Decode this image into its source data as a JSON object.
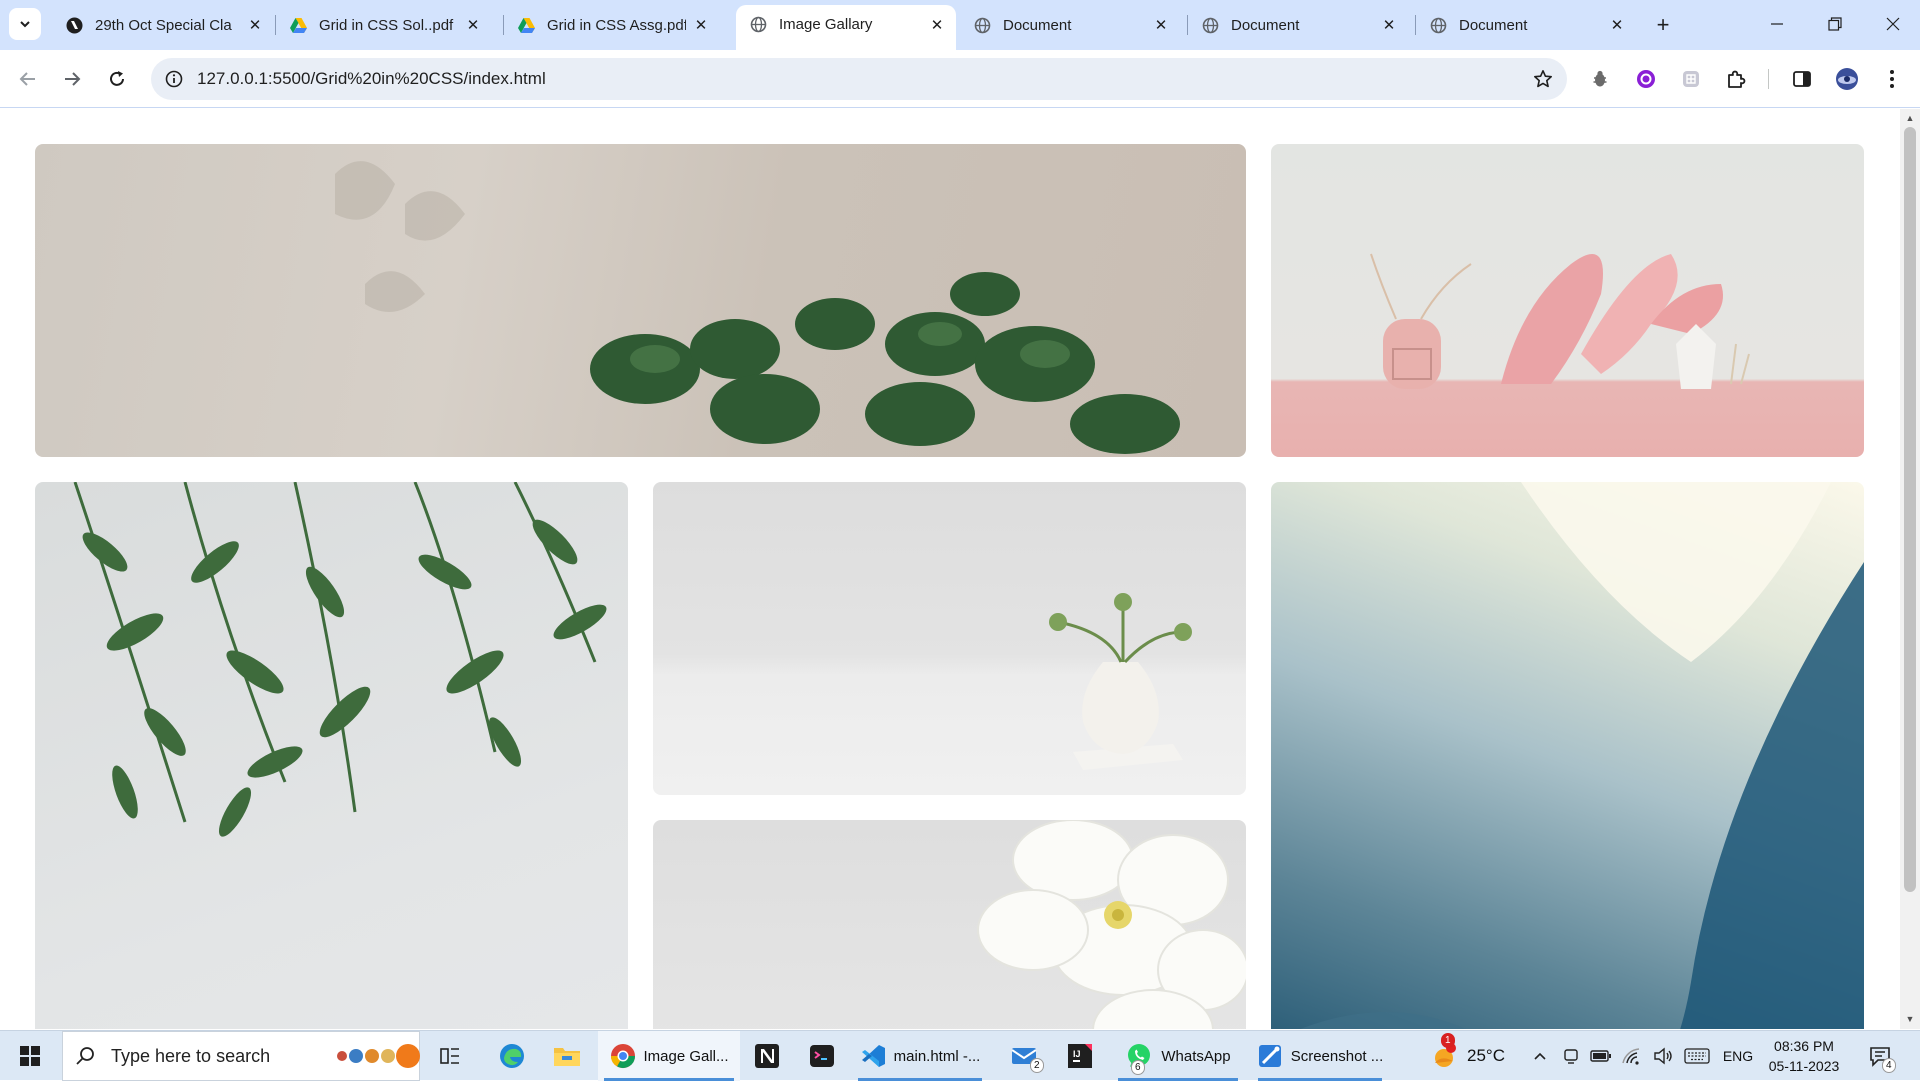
{
  "browser": {
    "tabs": [
      {
        "title": "29th Oct Special Cla",
        "favicon": "notion-icon",
        "active": false
      },
      {
        "title": "Grid in CSS Sol..pdf",
        "favicon": "google-drive-icon",
        "active": false
      },
      {
        "title": "Grid in CSS Assg.pdf",
        "favicon": "google-drive-icon",
        "active": false
      },
      {
        "title": "Image Gallary",
        "favicon": "globe-icon",
        "active": true
      },
      {
        "title": "Document",
        "favicon": "globe-icon",
        "active": false
      },
      {
        "title": "Document",
        "favicon": "globe-icon",
        "active": false
      },
      {
        "title": "Document",
        "favicon": "globe-icon",
        "active": false
      }
    ],
    "url": "127.0.0.1:5500/Grid%20in%20CSS/index.html",
    "extensions": [
      "bug-extension-icon",
      "purple-extension-icon",
      "grid-extension-icon",
      "puzzle-icon",
      "side-panel-icon",
      "profile-avatar"
    ]
  },
  "gallery": {
    "images": [
      {
        "name": "pilea-plant-shadows",
        "description_colors": [
          "#cfc9c1",
          "#2f5a33"
        ]
      },
      {
        "name": "pink-dried-palm-shelf",
        "description_colors": [
          "#e6e5e2",
          "#e8b0ae"
        ]
      },
      {
        "name": "hanging-green-leaves",
        "description_colors": [
          "#e3e5e6",
          "#3e6b3c"
        ]
      },
      {
        "name": "white-vase-green-stems",
        "description_colors": [
          "#e3e3e3",
          "#f3f1ec"
        ]
      },
      {
        "name": "abstract-blue-curve",
        "description_colors": [
          "#fbf8ea",
          "#0f4766"
        ]
      },
      {
        "name": "white-flower-closeup",
        "description_colors": [
          "#e8e8e8",
          "#fbfbf8"
        ]
      }
    ]
  },
  "taskbar": {
    "search_placeholder": "Type here to search",
    "apps": [
      {
        "label": "Image Gall...",
        "icon": "chrome-icon"
      },
      {
        "label": "main.html -...",
        "icon": "vscode-icon"
      },
      {
        "label": "WhatsApp",
        "icon": "whatsapp-icon",
        "badge": "6"
      },
      {
        "label": "Screenshot ...",
        "icon": "screenshot-icon"
      }
    ],
    "mail_badge": "2",
    "weather": {
      "temp": "25°C",
      "alert": "1"
    },
    "language": "ENG",
    "time": "08:36 PM",
    "date": "05-11-2023",
    "notification_count": "4"
  }
}
